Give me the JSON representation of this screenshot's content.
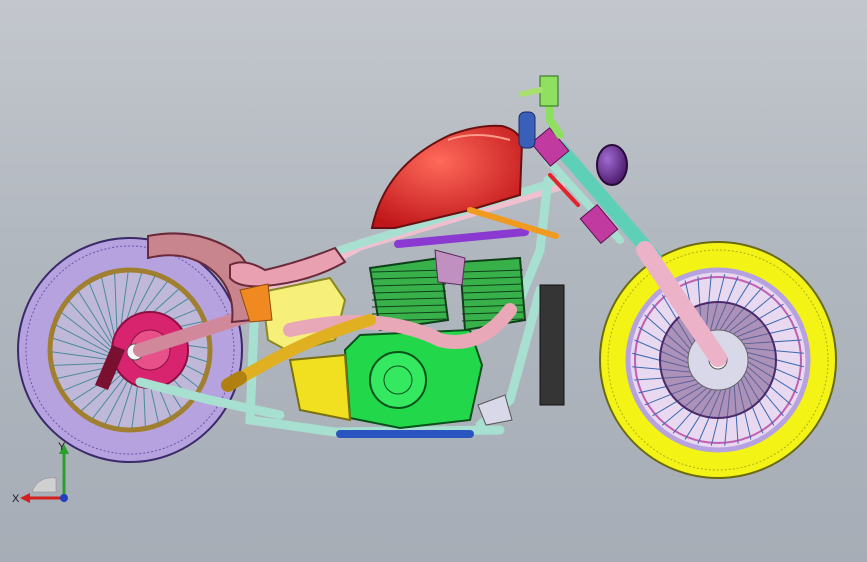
{
  "viewport": {
    "background_top": "#c3c7cd",
    "background_bottom": "#a7adb6"
  },
  "model": {
    "parts": {
      "rear_tire": "#b7a2e0",
      "rear_rim": "#c9b16a",
      "rear_hub": "#d8246e",
      "front_tire": "#f3f316",
      "front_rim": "#b7a2e0",
      "front_disc": "#7a5a8a",
      "fuel_tank": "#e0262a",
      "rear_fender": "#c9858e",
      "seat": "#e9a0b0",
      "frame": "#a7e0d0",
      "top_tube": "#f0c0d0",
      "oil_tank": "#f6f07a",
      "engine_cylinders": "#38b14a",
      "engine_cases": "#22d84a",
      "exhaust": "#e8a8b8",
      "exhaust_tip": "#e0b020",
      "fork": "#5fd0b8",
      "fork_lower": "#ecb2c8",
      "headlight": "#6a2a8a",
      "handlebar": "#8fe060",
      "grip": "#3a5fb8",
      "triple_clamp": "#c03aa0",
      "purple_bar": "#8a3ad0",
      "orange_bar": "#f09a20",
      "foot_control": "#2a55c0",
      "swingarm": "#d0889a",
      "radiator": "#353535",
      "sprocket": "#f0f04a"
    }
  },
  "triad": {
    "x_label": "X",
    "y_label": "Y",
    "x_color": "#d4201e",
    "y_color": "#2aa02a",
    "z_color": "#2040c0"
  }
}
